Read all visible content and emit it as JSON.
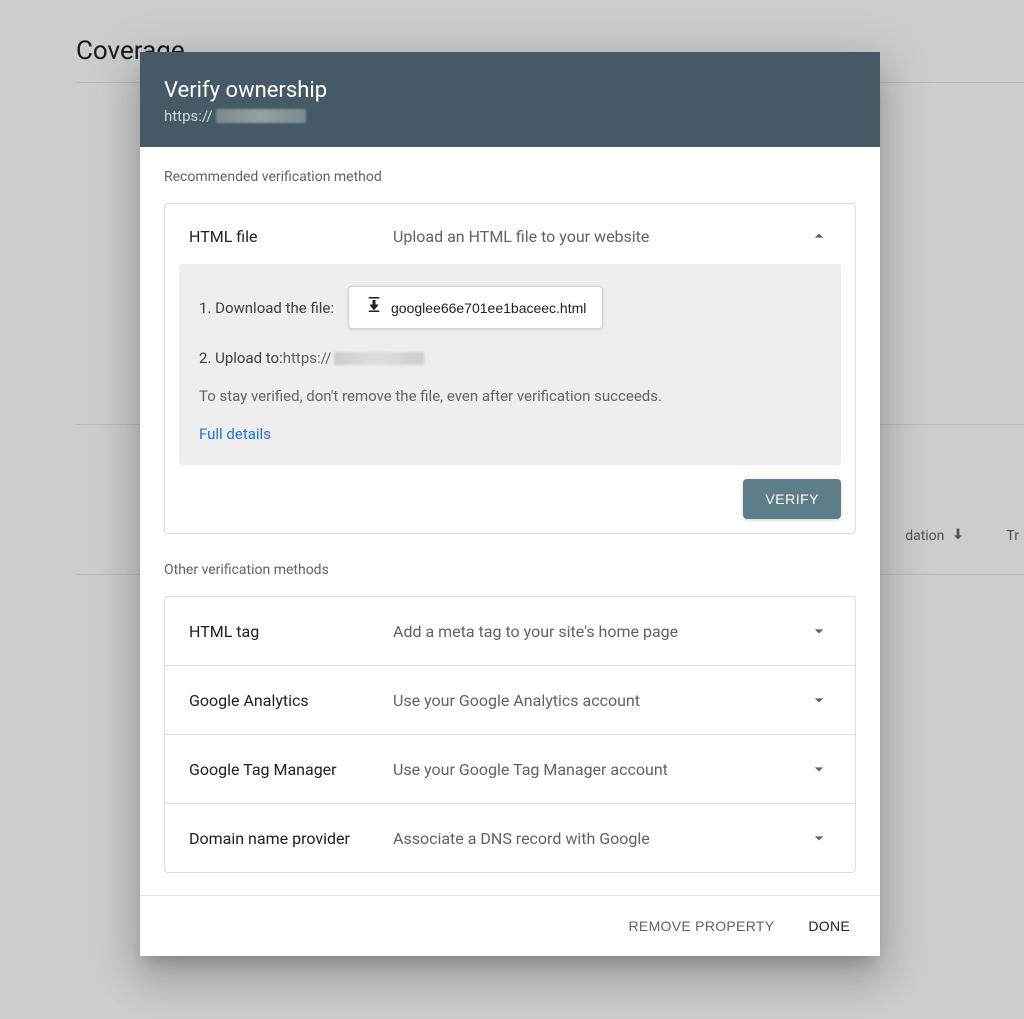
{
  "background": {
    "page_title": "Coverage",
    "columns": {
      "validation": "dation",
      "trend": "Tr"
    }
  },
  "dialog": {
    "title": "Verify ownership",
    "subtitle_prefix": "https://",
    "recommended_label": "Recommended verification method",
    "recommended": {
      "method": "HTML file",
      "description": "Upload an HTML file to your website",
      "step1_label": "1. Download the file:",
      "download_filename": "googlee66e701ee1baceec.html",
      "step2_label": "2. Upload to: ",
      "step2_url_prefix": "https://",
      "note": "To stay verified, don't remove the file, even after verification succeeds.",
      "details_link": "Full details",
      "verify_button": "VERIFY"
    },
    "other_label": "Other verification methods",
    "other_methods": [
      {
        "method": "HTML tag",
        "description": "Add a meta tag to your site's home page"
      },
      {
        "method": "Google Analytics",
        "description": "Use your Google Analytics account"
      },
      {
        "method": "Google Tag Manager",
        "description": "Use your Google Tag Manager account"
      },
      {
        "method": "Domain name provider",
        "description": "Associate a DNS record with Google"
      }
    ],
    "footer": {
      "remove": "REMOVE PROPERTY",
      "done": "DONE"
    }
  }
}
